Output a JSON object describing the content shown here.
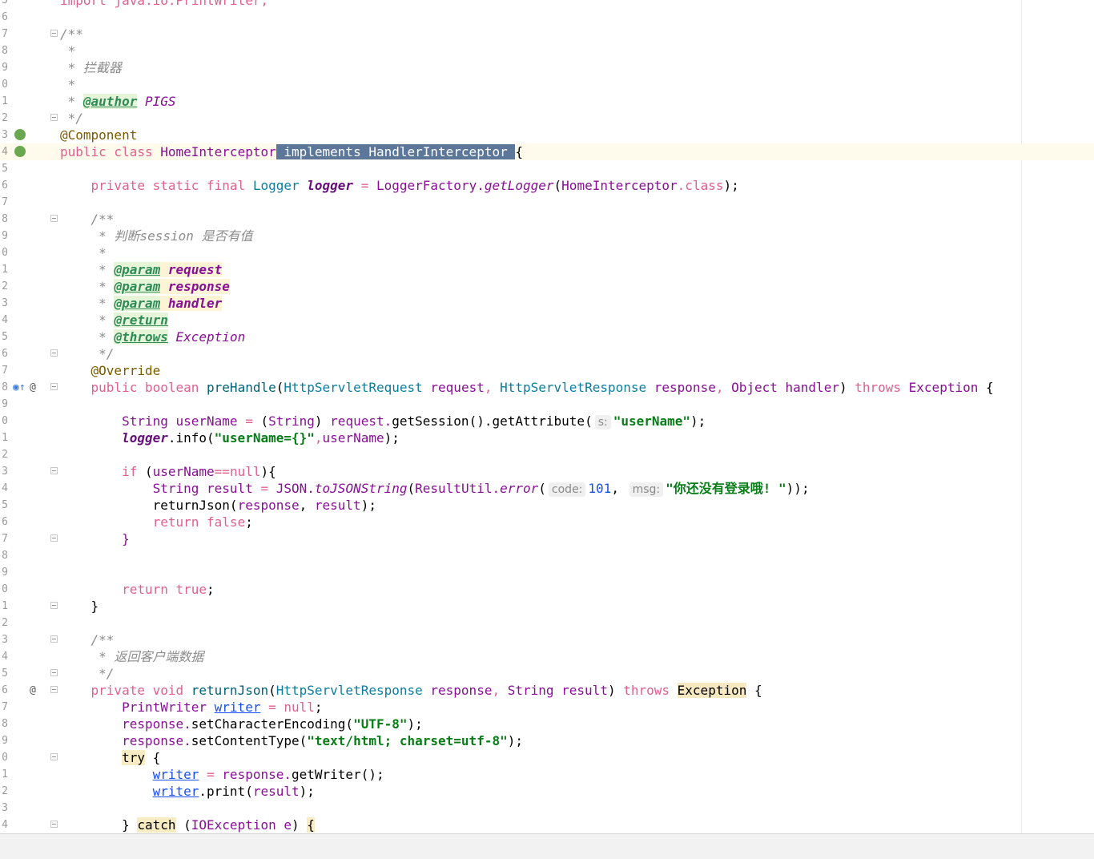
{
  "editor": {
    "lines": [
      {
        "n": "5",
        "tokens": [
          [
            "kw",
            "import "
          ],
          [
            "kw",
            "java.io.PrintWriter;"
          ]
        ]
      },
      {
        "n": "6",
        "tokens": []
      },
      {
        "n": "7",
        "fold": true,
        "tokens": [
          [
            "cmt",
            "/**"
          ]
        ]
      },
      {
        "n": "8",
        "tokens": [
          [
            "cmt",
            " *"
          ]
        ]
      },
      {
        "n": "9",
        "tokens": [
          [
            "cmt",
            " * 拦截器"
          ]
        ]
      },
      {
        "n": "0",
        "tokens": [
          [
            "cmt",
            " *"
          ]
        ]
      },
      {
        "n": "1",
        "tokens": [
          [
            "cmt",
            " * "
          ],
          [
            "jdt",
            "@author"
          ],
          [
            "jdx",
            " PIGS"
          ]
        ]
      },
      {
        "n": "2",
        "fold": true,
        "tokens": [
          [
            "cmt",
            " */"
          ]
        ]
      },
      {
        "n": "3",
        "icon": "bean-icon",
        "tokens": [
          [
            "ann",
            "@Component"
          ]
        ]
      },
      {
        "n": "4",
        "icon": "bean-class-icon",
        "current": true,
        "tokens": [
          [
            "kw",
            "public class "
          ],
          [
            "typ",
            "HomeInterceptor"
          ],
          [
            "sel",
            " implements HandlerInterceptor "
          ],
          [
            "",
            "{"
          ]
        ]
      },
      {
        "n": "5",
        "tokens": []
      },
      {
        "n": "6",
        "tokens": [
          [
            "",
            "    "
          ],
          [
            "kw",
            "private static final "
          ],
          [
            "cls",
            "Logger "
          ],
          [
            "fieldst",
            "logger"
          ],
          [
            "kw",
            " = "
          ],
          [
            "typ",
            "LoggerFactory."
          ],
          [
            "stcall",
            "getLogger"
          ],
          [
            "",
            "("
          ],
          [
            "typ",
            "HomeInterceptor"
          ],
          [
            "kw",
            ".class"
          ],
          [
            "",
            ");"
          ]
        ]
      },
      {
        "n": "7",
        "tokens": []
      },
      {
        "n": "8",
        "fold": true,
        "tokens": [
          [
            "",
            "    "
          ],
          [
            "cmt",
            "/**"
          ]
        ]
      },
      {
        "n": "9",
        "tokens": [
          [
            "",
            "    "
          ],
          [
            "cmt",
            " * 判断session 是否有值"
          ]
        ]
      },
      {
        "n": "0",
        "tokens": [
          [
            "",
            "    "
          ],
          [
            "cmt",
            " *"
          ]
        ]
      },
      {
        "n": "1",
        "tokens": [
          [
            "",
            "    "
          ],
          [
            "cmt",
            " * "
          ],
          [
            "jdt",
            "@param"
          ],
          [
            "",
            ""
          ],
          [
            "jdp",
            " request"
          ]
        ]
      },
      {
        "n": "2",
        "tokens": [
          [
            "",
            "    "
          ],
          [
            "cmt",
            " * "
          ],
          [
            "jdt",
            "@param"
          ],
          [
            "jdp",
            " response"
          ]
        ]
      },
      {
        "n": "3",
        "tokens": [
          [
            "",
            "    "
          ],
          [
            "cmt",
            " * "
          ],
          [
            "jdt",
            "@param"
          ],
          [
            "jdp",
            " handler"
          ]
        ]
      },
      {
        "n": "4",
        "tokens": [
          [
            "",
            "    "
          ],
          [
            "cmt",
            " * "
          ],
          [
            "jdt",
            "@return"
          ]
        ]
      },
      {
        "n": "5",
        "tokens": [
          [
            "",
            "    "
          ],
          [
            "cmt",
            " * "
          ],
          [
            "jdt",
            "@throws"
          ],
          [
            "jdx",
            " Exception"
          ]
        ]
      },
      {
        "n": "6",
        "fold": true,
        "tokens": [
          [
            "",
            "    "
          ],
          [
            "cmt",
            " */"
          ]
        ]
      },
      {
        "n": "7",
        "tokens": [
          [
            "",
            "    "
          ],
          [
            "ann",
            "@Override"
          ]
        ]
      },
      {
        "n": "8",
        "icon": "override-icon",
        "at": true,
        "fold": true,
        "tokens": [
          [
            "",
            "    "
          ],
          [
            "kw",
            "public boolean "
          ],
          [
            "meth",
            "preHandle"
          ],
          [
            "",
            "("
          ],
          [
            "cls",
            "HttpServletRequest "
          ],
          [
            "typ",
            "request"
          ],
          [
            "kw",
            ", "
          ],
          [
            "cls",
            "HttpServletResponse "
          ],
          [
            "typ",
            "response"
          ],
          [
            "kw",
            ", "
          ],
          [
            "typ",
            "Object handler"
          ],
          [
            "",
            ") "
          ],
          [
            "kw",
            "throws "
          ],
          [
            "typ",
            "Exception "
          ],
          [
            "",
            "{"
          ]
        ]
      },
      {
        "n": "9",
        "tokens": []
      },
      {
        "n": "0",
        "tokens": [
          [
            "",
            "        "
          ],
          [
            "typ",
            "String userName"
          ],
          [
            "kw",
            " = "
          ],
          [
            "",
            "("
          ],
          [
            "typ",
            "String"
          ],
          [
            "",
            ") "
          ],
          [
            "typ",
            "request."
          ],
          [
            "",
            "getSession()."
          ],
          [
            "",
            "getAttribute("
          ],
          [
            "hint",
            "s:"
          ],
          [
            "str",
            "\"userName\""
          ],
          [
            "",
            ");"
          ]
        ]
      },
      {
        "n": "1",
        "tokens": [
          [
            "",
            "        "
          ],
          [
            "fieldst",
            "logger"
          ],
          [
            "",
            ".info("
          ],
          [
            "str",
            "\"userName={}\""
          ],
          [
            "kw",
            ","
          ],
          [
            "typ",
            "userName"
          ],
          [
            "",
            ");"
          ]
        ]
      },
      {
        "n": "2",
        "tokens": []
      },
      {
        "n": "3",
        "fold": true,
        "tokens": [
          [
            "",
            "        "
          ],
          [
            "kw",
            "if "
          ],
          [
            "",
            "("
          ],
          [
            "typ",
            "userName"
          ],
          [
            "kw",
            "=="
          ],
          [
            "kw",
            "null"
          ],
          [
            "",
            "){"
          ]
        ]
      },
      {
        "n": "4",
        "tokens": [
          [
            "",
            "            "
          ],
          [
            "typ",
            "String result"
          ],
          [
            "kw",
            " = "
          ],
          [
            "typ",
            "JSON."
          ],
          [
            "stcall",
            "toJSONString"
          ],
          [
            "",
            "("
          ],
          [
            "typ",
            "ResultUtil."
          ],
          [
            "stcall",
            "error"
          ],
          [
            "",
            "("
          ],
          [
            "hint",
            "code:"
          ],
          [
            "num",
            "101"
          ],
          [
            "",
            ", "
          ],
          [
            "hint",
            "msg:"
          ],
          [
            "str",
            "\"你还没有登录哦! \""
          ],
          [
            "",
            "));"
          ]
        ]
      },
      {
        "n": "5",
        "tokens": [
          [
            "",
            "            "
          ],
          [
            "",
            "returnJson("
          ],
          [
            "typ",
            "response"
          ],
          [
            "",
            ", "
          ],
          [
            "typ",
            "result"
          ],
          [
            "",
            ");"
          ]
        ]
      },
      {
        "n": "6",
        "tokens": [
          [
            "",
            "            "
          ],
          [
            "kw",
            "return false"
          ],
          [
            "",
            ";"
          ]
        ]
      },
      {
        "n": "7",
        "fold": true,
        "tokens": [
          [
            "",
            "        "
          ],
          [
            "typ",
            "}"
          ]
        ]
      },
      {
        "n": "8",
        "tokens": []
      },
      {
        "n": "9",
        "tokens": []
      },
      {
        "n": "0",
        "tokens": [
          [
            "",
            "        "
          ],
          [
            "kw",
            "return true"
          ],
          [
            "",
            ";"
          ]
        ]
      },
      {
        "n": "1",
        "fold": true,
        "tokens": [
          [
            "",
            "    "
          ],
          [
            "",
            "}"
          ]
        ]
      },
      {
        "n": "2",
        "tokens": []
      },
      {
        "n": "3",
        "fold": true,
        "tokens": [
          [
            "",
            "    "
          ],
          [
            "cmt",
            "/**"
          ]
        ]
      },
      {
        "n": "4",
        "tokens": [
          [
            "",
            "    "
          ],
          [
            "cmt",
            " * 返回客户端数据"
          ]
        ]
      },
      {
        "n": "5",
        "fold": true,
        "tokens": [
          [
            "",
            "    "
          ],
          [
            "cmt",
            " */"
          ]
        ]
      },
      {
        "n": "6",
        "at": true,
        "fold": true,
        "tokens": [
          [
            "",
            "    "
          ],
          [
            "kw",
            "private void "
          ],
          [
            "meth",
            "returnJson"
          ],
          [
            "",
            "("
          ],
          [
            "cls",
            "HttpServletResponse "
          ],
          [
            "typ",
            "response"
          ],
          [
            "kw",
            ", "
          ],
          [
            "typ",
            "String result"
          ],
          [
            "",
            ") "
          ],
          [
            "kw",
            "throws "
          ],
          [
            "hlexc",
            "Exception"
          ],
          [
            "",
            " {"
          ]
        ]
      },
      {
        "n": "7",
        "tokens": [
          [
            "",
            "        "
          ],
          [
            "typ",
            "PrintWriter "
          ],
          [
            "var",
            "writer"
          ],
          [
            "kw",
            " = null"
          ],
          [
            "",
            ";"
          ]
        ]
      },
      {
        "n": "8",
        "tokens": [
          [
            "",
            "        "
          ],
          [
            "typ",
            "response."
          ],
          [
            "",
            "setCharacterEncoding("
          ],
          [
            "str",
            "\"UTF-8\""
          ],
          [
            "",
            ");"
          ]
        ]
      },
      {
        "n": "9",
        "tokens": [
          [
            "",
            "        "
          ],
          [
            "typ",
            "response."
          ],
          [
            "",
            "setContentType("
          ],
          [
            "str",
            "\"text/html; charset=utf-8\""
          ],
          [
            "",
            ");"
          ]
        ]
      },
      {
        "n": "0",
        "fold": true,
        "tokens": [
          [
            "",
            "        "
          ],
          [
            "hlwarn",
            "try"
          ],
          [
            "",
            " {"
          ]
        ]
      },
      {
        "n": "1",
        "tokens": [
          [
            "",
            "            "
          ],
          [
            "var",
            "writer"
          ],
          [
            "kw",
            " = "
          ],
          [
            "typ",
            "response."
          ],
          [
            "",
            "getWriter();"
          ]
        ]
      },
      {
        "n": "2",
        "tokens": [
          [
            "",
            "            "
          ],
          [
            "var",
            "writer"
          ],
          [
            "",
            ".print("
          ],
          [
            "typ",
            "result"
          ],
          [
            "",
            ");"
          ]
        ]
      },
      {
        "n": "3",
        "tokens": []
      },
      {
        "n": "4",
        "fold": true,
        "tokens": [
          [
            "",
            "        "
          ],
          [
            "",
            "} "
          ],
          [
            "hlwarn",
            "catch"
          ],
          [
            "",
            " ("
          ],
          [
            "typ",
            "IOException e"
          ],
          [
            "",
            ") "
          ],
          [
            "hlwarn",
            "{"
          ]
        ]
      }
    ]
  }
}
